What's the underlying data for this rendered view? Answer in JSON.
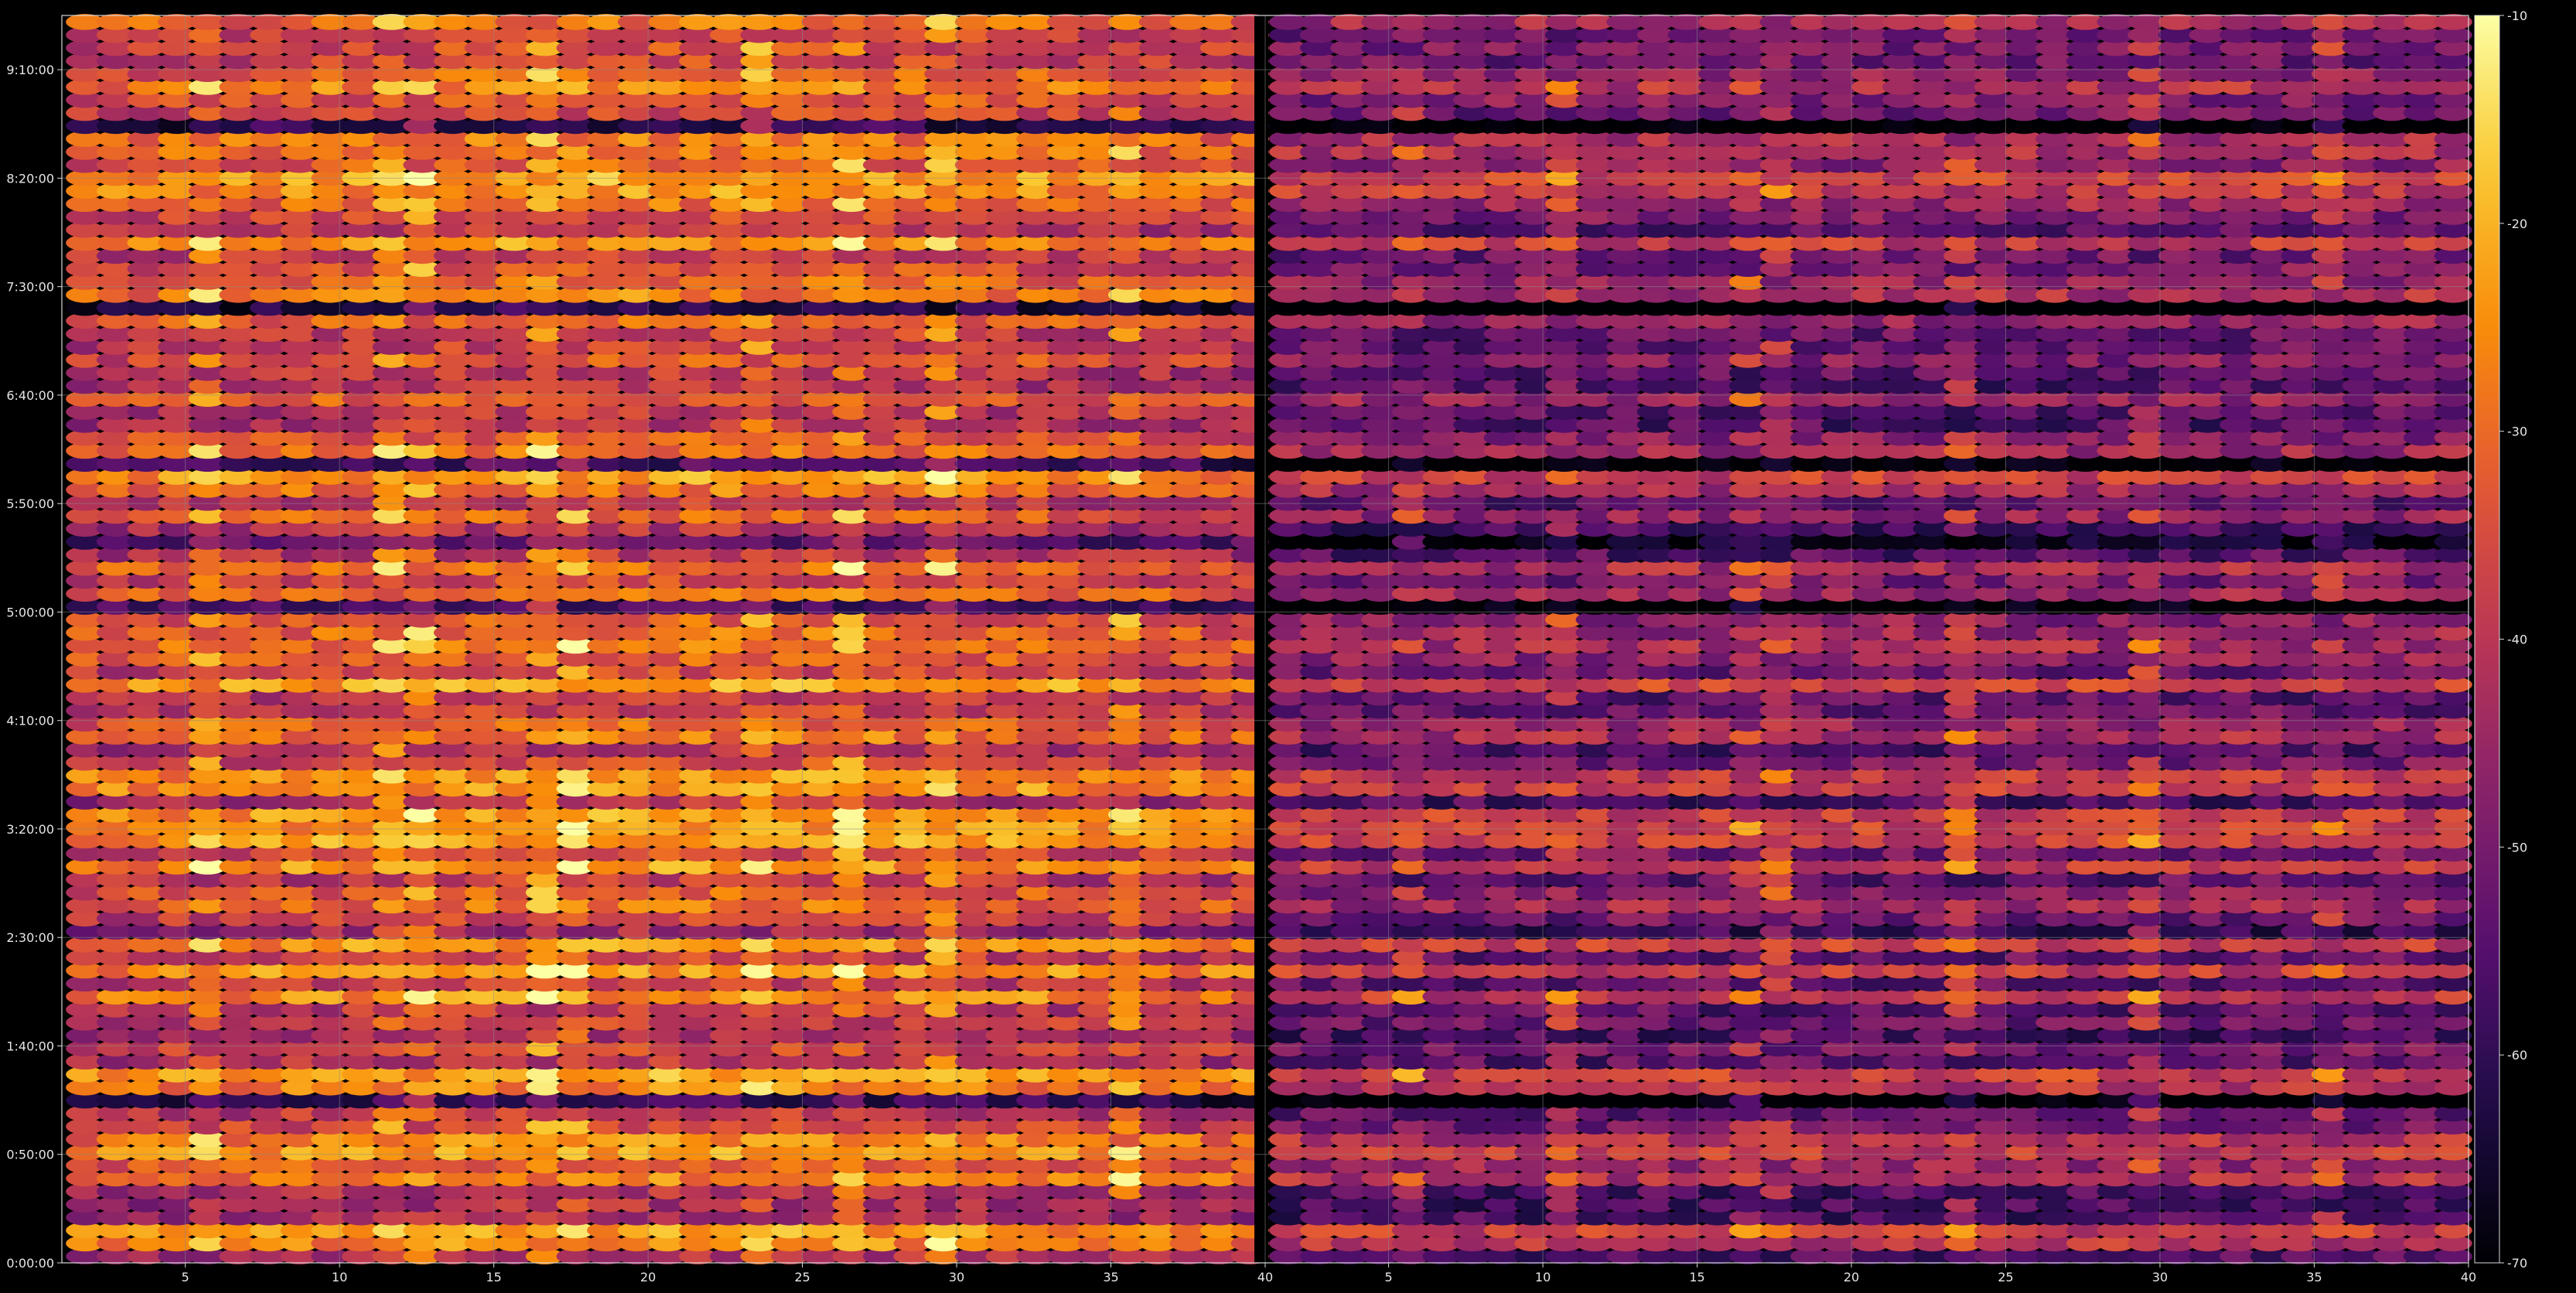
{
  "chart_data": {
    "type": "heatmap",
    "title": "",
    "xlabel": "",
    "ylabel": "",
    "grid": true,
    "panels": [
      {
        "name": "",
        "x_range": [
          1,
          40
        ],
        "x_ticks": [
          "5",
          "10",
          "15",
          "20",
          "25",
          "30",
          "35",
          "40"
        ],
        "rows": 96,
        "columns": 39,
        "hot_spots_x": [
          5,
          11,
          12,
          16,
          17,
          23,
          26,
          29,
          35
        ],
        "note_intensity": "warmer overall"
      },
      {
        "name": "",
        "x_range": [
          1,
          40
        ],
        "x_ticks": [
          "5",
          "10",
          "15",
          "20",
          "25",
          "30",
          "35",
          "40"
        ],
        "rows": 96,
        "columns": 39,
        "hot_spots_x": [
          5,
          10,
          16,
          17,
          23,
          29,
          35
        ],
        "note_intensity": "cooler overall"
      }
    ],
    "y_ticks": [
      "0:00:00",
      "0:50:00",
      "1:40:00",
      "2:30:00",
      "3:20:00",
      "4:10:00",
      "5:00:00",
      "5:50:00",
      "6:40:00",
      "7:30:00",
      "8:20:00",
      "9:10:00"
    ],
    "y_range_seconds": [
      0,
      34500
    ],
    "colorbar": {
      "colormap": "inferno",
      "range": [
        -70,
        -10
      ],
      "ticks": [
        "-10",
        "-20",
        "-30",
        "-40",
        "-50",
        "-60",
        "-70"
      ]
    },
    "colors": {
      "background": "#000000",
      "grid": "#8a8a8a",
      "axis": "#d8d8d8",
      "tick_label": "#e6e6e6"
    }
  }
}
